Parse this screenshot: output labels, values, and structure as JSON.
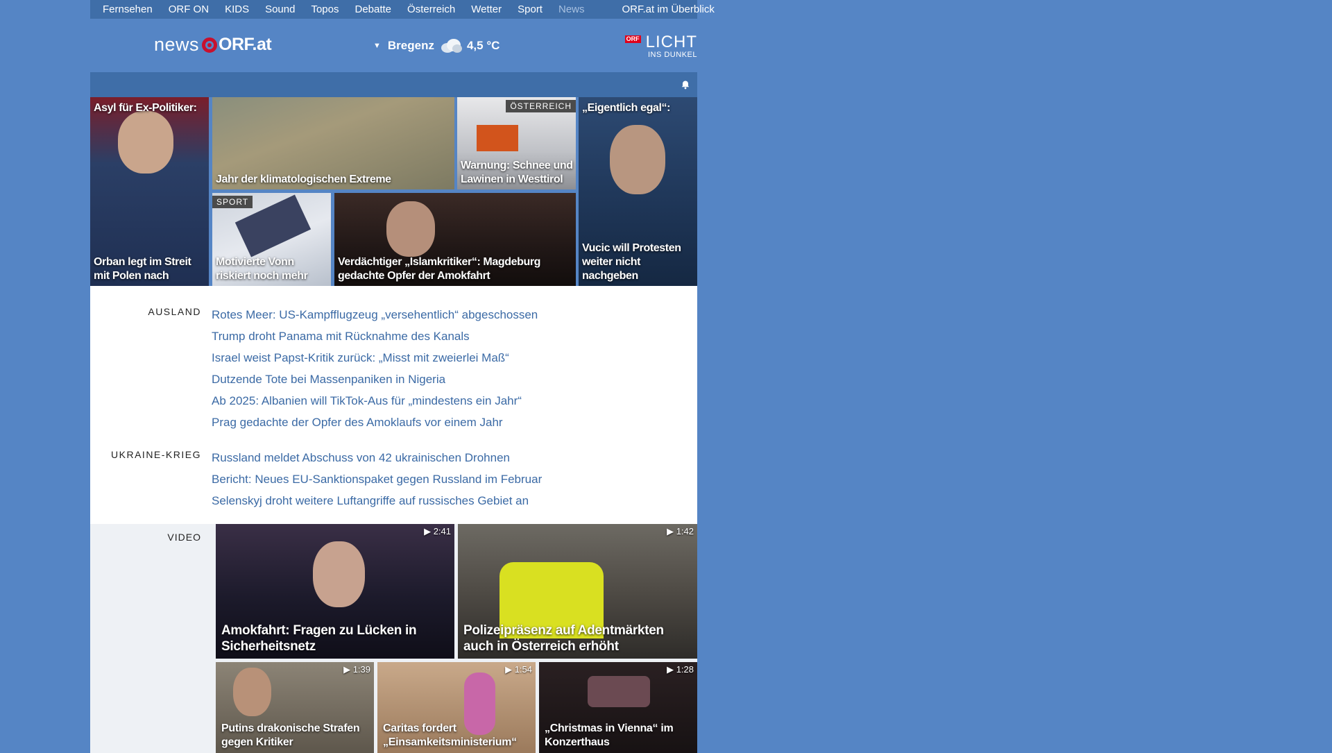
{
  "topnav": {
    "items": [
      "Fernsehen",
      "ORF ON",
      "KIDS",
      "Sound",
      "Topos",
      "Debatte",
      "Österreich",
      "Wetter",
      "Sport",
      "News"
    ],
    "overview": "ORF.at im Überblick"
  },
  "header": {
    "logo_news": "news",
    "logo_orf": "ORF.at",
    "weather_city": "Bregenz",
    "weather_temp": "4,5 °C",
    "licht_badge": "ORF",
    "licht_big": "LICHT",
    "licht_small": "INS DUNKEL"
  },
  "tiles": [
    {
      "top": "Asyl für Ex-Politiker:",
      "caption": "Orban legt im Streit mit Polen nach"
    },
    {
      "caption": "Jahr der klimatologischen Extreme"
    },
    {
      "tag": "ÖSTERREICH",
      "caption": "Warnung: Schnee und Lawinen in Westtirol"
    },
    {
      "top": "„Eigentlich egal“:",
      "caption": "Vucic will Protesten weiter nicht nachgeben"
    },
    {
      "tag": "SPORT",
      "caption": "Motivierte Vonn riskiert noch mehr"
    },
    {
      "caption": "Verdächtiger „Islamkritiker“: Magdeburg gedachte Opfer der Amokfahrt"
    }
  ],
  "ausland": {
    "label": "AUSLAND",
    "items": [
      "Rotes Meer: US-Kampfflugzeug „versehentlich“ abgeschossen",
      "Trump droht Panama mit Rücknahme des Kanals",
      "Israel weist Papst-Kritik zurück: „Misst mit zweierlei Maß“",
      "Dutzende Tote bei Massenpaniken in Nigeria",
      "Ab 2025: Albanien will TikTok-Aus für „mindestens ein Jahr“",
      "Prag gedachte der Opfer des Amoklaufs vor einem Jahr"
    ]
  },
  "ukraine": {
    "label": "UKRAINE-KRIEG",
    "items": [
      "Russland meldet Abschuss von 42 ukrainischen Drohnen",
      "Bericht: Neues EU-Sanktionspaket gegen Russland im Februar",
      "Selenskyj droht weitere Luftangriffe auf russisches Gebiet an"
    ]
  },
  "video": {
    "label": "VIDEO",
    "items": [
      {
        "duration": "2:41",
        "caption": "Amokfahrt: Fragen zu Lücken in Sicherheitsnetz"
      },
      {
        "duration": "1:42",
        "caption": "Polizeipräsenz auf Adentmärkten auch in Österreich erhöht"
      },
      {
        "duration": "1:39",
        "caption": "Putins drakonische Strafen gegen Kritiker"
      },
      {
        "duration": "1:54",
        "caption": "Caritas fordert „Einsamkeitsministerium“"
      },
      {
        "duration": "1:28",
        "caption": "„Christmas in Vienna“ im Konzerthaus"
      }
    ]
  },
  "colors": {
    "background": "#5585c5",
    "nav_bar": "#3f6ea8",
    "link": "#3b6aa5",
    "orf_red": "#c8102e"
  }
}
